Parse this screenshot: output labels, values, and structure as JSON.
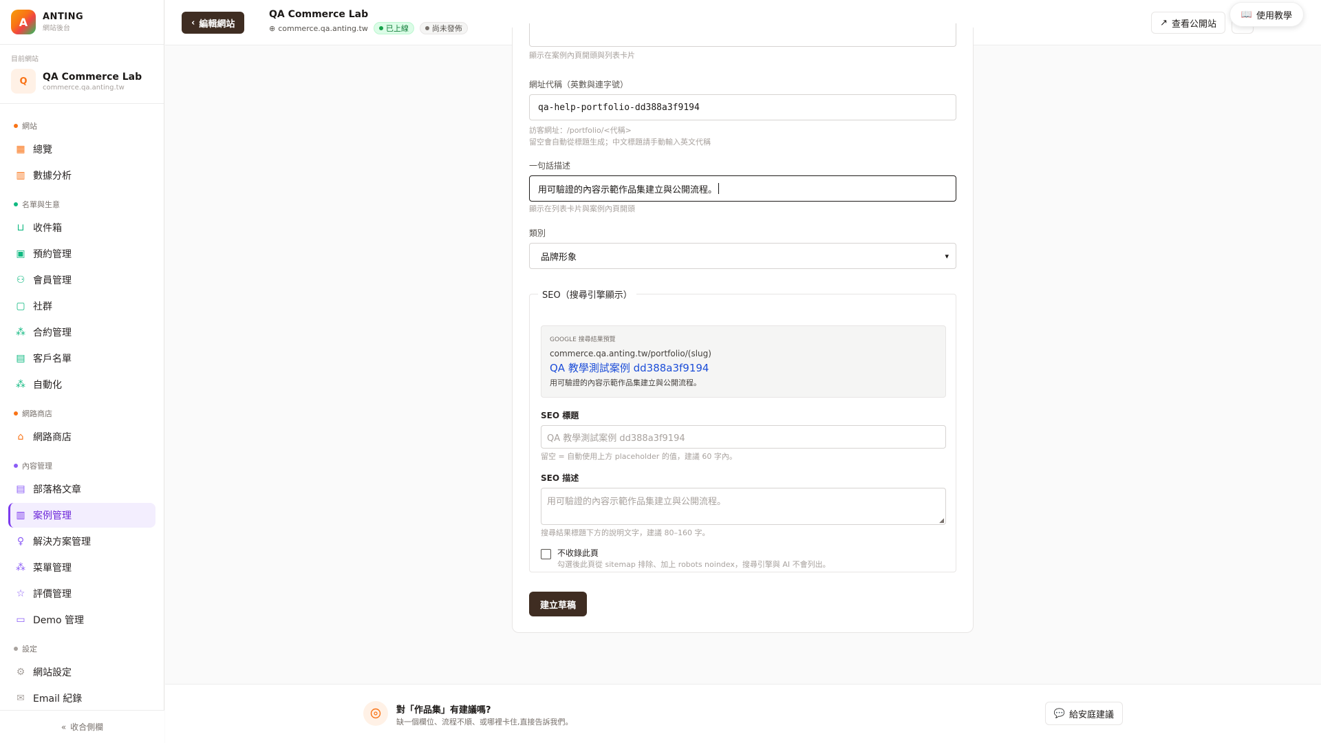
{
  "brand": {
    "logo_letter": "A",
    "name": "ANTING",
    "subtitle": "網站後台"
  },
  "current_site": {
    "label": "目前網站",
    "avatar_letter": "Q",
    "name": "QA Commerce Lab",
    "domain": "commerce.qa.anting.tw"
  },
  "nav": {
    "groups": [
      {
        "label": "網站",
        "color": "#f97316",
        "items": [
          {
            "label": "總覽",
            "icon": "grid-icon"
          },
          {
            "label": "數據分析",
            "icon": "bar-chart-icon"
          }
        ]
      },
      {
        "label": "名單與生意",
        "color": "#10b981",
        "items": [
          {
            "label": "收件箱",
            "icon": "inbox-icon"
          },
          {
            "label": "預約管理",
            "icon": "calendar-icon"
          },
          {
            "label": "會員管理",
            "icon": "users-icon"
          },
          {
            "label": "社群",
            "icon": "chat-icon"
          },
          {
            "label": "合約管理",
            "icon": "workflow-icon"
          },
          {
            "label": "客戶名單",
            "icon": "contact-icon"
          },
          {
            "label": "自動化",
            "icon": "workflow-icon"
          }
        ]
      },
      {
        "label": "網路商店",
        "color": "#f97316",
        "items": [
          {
            "label": "網路商店",
            "icon": "store-icon"
          }
        ]
      },
      {
        "label": "內容管理",
        "color": "#8b5cf6",
        "items": [
          {
            "label": "部落格文章",
            "icon": "document-icon"
          },
          {
            "label": "案例管理",
            "icon": "briefcase-icon",
            "active": true
          },
          {
            "label": "解決方案管理",
            "icon": "lightbulb-icon"
          },
          {
            "label": "菜單管理",
            "icon": "workflow-icon"
          },
          {
            "label": "評價管理",
            "icon": "star-icon"
          },
          {
            "label": "Demo 管理",
            "icon": "presentation-icon"
          }
        ]
      },
      {
        "label": "設定",
        "color": "#a8a29e",
        "items": [
          {
            "label": "網站設定",
            "icon": "gear-icon"
          },
          {
            "label": "Email 紀錄",
            "icon": "mail-icon"
          }
        ]
      }
    ],
    "collapse_label": "收合側欄"
  },
  "topbar": {
    "back_label": "編輯網站",
    "site_title": "QA Commerce Lab",
    "site_domain": "commerce.qa.anting.tw",
    "badge_live": "已上線",
    "badge_draft": "尚未發佈",
    "view_site_label": "查看公開站",
    "help_label": "使用教學"
  },
  "form": {
    "top_hint": "顯示在案例內頁開頭與列表卡片",
    "slug": {
      "label": "網址代稱（英數與連字號）",
      "value": "qa-help-portfolio-dd388a3f9194",
      "hint1": "訪客網址：/portfolio/<代稱>",
      "hint2": "留空會自動從標題生成；中文標題請手動輸入英文代稱"
    },
    "tagline": {
      "label": "一句話描述",
      "value": "用可驗證的內容示範作品集建立與公開流程。",
      "hint": "顯示在列表卡片與案例內頁開頭"
    },
    "category": {
      "label": "類別",
      "value": "品牌形象"
    },
    "seo": {
      "legend": "SEO（搜尋引擎顯示）",
      "preview_label": "GOOGLE 搜尋結果預覽",
      "preview_url": "commerce.qa.anting.tw/portfolio/(slug)",
      "preview_title": "QA 教學測試案例 dd388a3f9194",
      "preview_desc": "用可驗證的內容示範作品集建立與公開流程。",
      "title_label": "SEO 標題",
      "title_placeholder": "QA 教學測試案例 dd388a3f9194",
      "title_hint": "留空 = 自動使用上方 placeholder 的值，建議 60 字內。",
      "desc_label": "SEO 描述",
      "desc_placeholder": "用可驗證的內容示範作品集建立與公開流程。",
      "desc_hint": "搜尋結果標題下方的說明文字，建議 80–160 字。",
      "noindex_label": "不收錄此頁",
      "noindex_hint": "勾選後此頁從 sitemap 排除、加上 robots noindex，搜尋引擎與 AI 不會列出。"
    },
    "submit_label": "建立草稿"
  },
  "feedback": {
    "title": "對「作品集」有建議嗎?",
    "subtitle": "缺一個欄位、流程不順、或哪裡卡住,直接告訴我們。",
    "button_label": "給安庭建議"
  }
}
